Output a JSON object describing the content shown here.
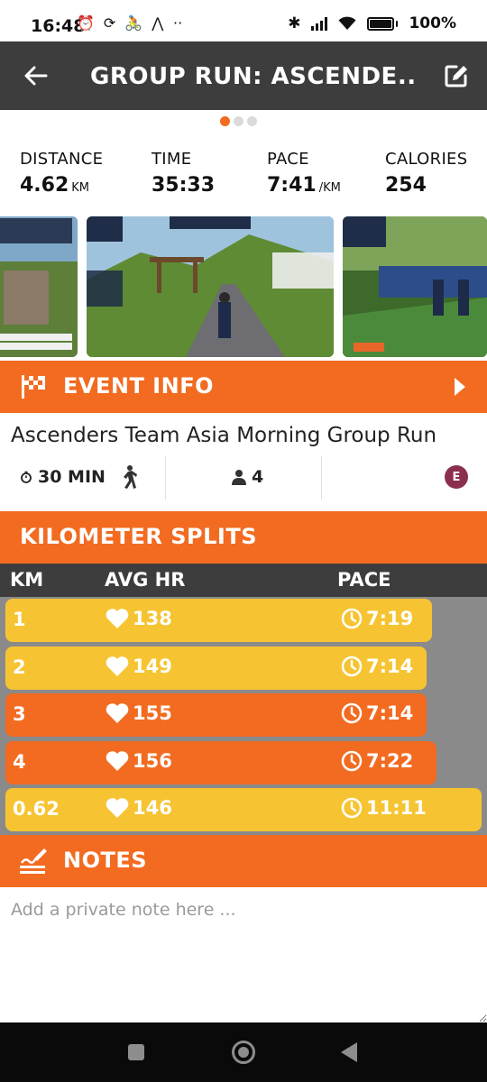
{
  "status_bar": {
    "time": "16:48",
    "battery": "100%"
  },
  "header": {
    "title": "GROUP RUN: ASCENDE..."
  },
  "pager": {
    "pages": 3,
    "active": 1
  },
  "stats": [
    {
      "label": "DISTANCE",
      "value": "4.62",
      "unit": "KM"
    },
    {
      "label": "TIME",
      "value": "35:33",
      "unit": ""
    },
    {
      "label": "PACE",
      "value": "7:41",
      "unit": "/KM"
    },
    {
      "label": "CALORIES",
      "value": "254",
      "unit": ""
    }
  ],
  "event_info": {
    "section_title": "EVENT INFO",
    "name": "Ascenders Team Asia Morning Group Run",
    "duration": "30 MIN",
    "participants": "4",
    "category": "E"
  },
  "splits": {
    "section_title": "KILOMETER SPLITS",
    "columns": {
      "km": "KM",
      "hr": "AVG HR",
      "pace": "PACE"
    },
    "rows": [
      {
        "km": "1",
        "hr": "138",
        "pace": "7:19",
        "color": "yellow",
        "hr_fraction": 0.895
      },
      {
        "km": "2",
        "hr": "149",
        "pace": "7:14",
        "color": "yellow",
        "hr_fraction": 0.885
      },
      {
        "km": "3",
        "hr": "155",
        "pace": "7:14",
        "color": "orange",
        "hr_fraction": 0.885
      },
      {
        "km": "4",
        "hr": "156",
        "pace": "7:22",
        "color": "orange",
        "hr_fraction": 0.905
      },
      {
        "km": "0.62",
        "hr": "146",
        "pace": "11:11",
        "color": "yellow",
        "hr_fraction": 1.0
      }
    ]
  },
  "notes": {
    "section_title": "NOTES",
    "placeholder": "Add a private note here ..."
  },
  "colors": {
    "accent": "#f26b21",
    "yellow": "#f6c432",
    "header_bg": "#3d3d3d",
    "splits_bg": "#8a8a8a"
  }
}
